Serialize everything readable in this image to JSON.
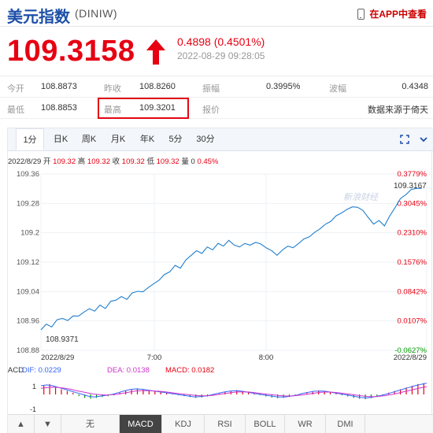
{
  "header": {
    "title": "美元指数",
    "code": "(DINIW)",
    "app_link": "在APP中查看"
  },
  "quote": {
    "price": "109.3158",
    "change": "0.4898 (0.4501%)",
    "time": "2022-08-29 09:28:05"
  },
  "stats": {
    "row1": [
      {
        "label": "今开",
        "value": "108.8873"
      },
      {
        "label": "昨收",
        "value": "108.8260"
      },
      {
        "label": "振幅",
        "value": "0.3995%"
      },
      {
        "label": "波幅",
        "value": "0.4348"
      }
    ],
    "row2": [
      {
        "label": "最低",
        "value": "108.8853"
      },
      {
        "label": "最高",
        "value": "109.3201"
      },
      {
        "label": "报价",
        "value": "数据来源于倚天"
      }
    ]
  },
  "tabs": [
    "1分",
    "日K",
    "周K",
    "月K",
    "年K",
    "5分",
    "30分"
  ],
  "info_line": {
    "date": "2022/8/29",
    "open_label": "开",
    "open": "109.32",
    "high_label": "高",
    "high": "109.32",
    "close_label": "收",
    "close": "109.32",
    "low_label": "低",
    "low": "109.32",
    "vol_label": "量",
    "vol": "0",
    "pct": "0.45%"
  },
  "bottom_tabs": [
    "无",
    "MACD",
    "KDJ",
    "RSI",
    "BOLL",
    "WR",
    "DMI"
  ],
  "chart_data": {
    "type": "line",
    "y_ticks": [
      "109.36",
      "109.28",
      "109.2",
      "109.12",
      "109.04",
      "108.96",
      "108.88"
    ],
    "pct_ticks": [
      "0.3779%",
      "0.3045%",
      "0.2310%",
      "0.1576%",
      "0.0842%",
      "0.0107%",
      "-0.0627%"
    ],
    "x_ticks": [
      "2022/8/29",
      "7:00",
      "8:00",
      "2022/8/29"
    ],
    "ylim": [
      108.88,
      109.36
    ],
    "annotations": {
      "min_label": "108.9371",
      "last_label": "109.3167"
    },
    "watermark": "新浪财经",
    "series": [
      {
        "values": [
          108.9371,
          108.95,
          108.945,
          108.962,
          108.968,
          108.96,
          108.975,
          108.972,
          108.985,
          108.992,
          108.988,
          109.002,
          108.995,
          109.012,
          109.018,
          109.025,
          109.02,
          109.035,
          109.042,
          109.038,
          109.052,
          109.06,
          109.072,
          109.085,
          109.095,
          109.11,
          109.105,
          109.125,
          109.14,
          109.15,
          109.145,
          109.16,
          109.155,
          109.17,
          109.165,
          109.178,
          109.168,
          109.16,
          109.172,
          109.165,
          109.175,
          109.168,
          109.16,
          109.15,
          109.14,
          109.152,
          109.165,
          109.158,
          109.172,
          109.182,
          109.19,
          109.2,
          109.212,
          109.222,
          109.232,
          109.245,
          109.255,
          109.262,
          109.272,
          109.268,
          109.262,
          109.24,
          109.225,
          109.232,
          109.22,
          109.245,
          109.27,
          109.292,
          109.305,
          109.3167,
          109.322,
          109.32
        ]
      }
    ],
    "macd": {
      "dif": "DIF: 0.0229",
      "dea": "DEA: 0.0138",
      "macd": "MACD: 0.0182",
      "y_ticks": [
        "1",
        "-1"
      ],
      "hist": [
        0.5,
        0.6,
        0.4,
        0.3,
        0.2,
        0.1,
        -0.1,
        -0.2,
        -0.25,
        -0.2,
        -0.15,
        -0.1,
        -0.05,
        0.1,
        0.2,
        0.3,
        0.35,
        0.3,
        0.25,
        0.2,
        0.15,
        0.1,
        0.05,
        -0.05,
        -0.1,
        -0.15,
        -0.2,
        -0.18,
        -0.12,
        -0.05,
        0.05,
        0.15,
        0.2,
        0.25,
        0.2,
        0.12,
        0.05,
        -0.05,
        -0.12,
        -0.18,
        -0.22,
        -0.2,
        -0.15,
        -0.08,
        0.05,
        0.12,
        0.18,
        0.22,
        0.18,
        0.12,
        0.05,
        -0.05,
        -0.12,
        -0.2,
        -0.25,
        -0.28,
        -0.22,
        -0.15,
        -0.05,
        0.1,
        0.2,
        0.3,
        0.4,
        0.5,
        0.6,
        0.65
      ],
      "dif_line": [
        0.5,
        0.55,
        0.5,
        0.4,
        0.3,
        0.2,
        0.1,
        0.0,
        -0.1,
        -0.15,
        -0.1,
        -0.05,
        0.0,
        0.1,
        0.2,
        0.28,
        0.32,
        0.3,
        0.25,
        0.2,
        0.15,
        0.1,
        0.05,
        0.0,
        -0.05,
        -0.1,
        -0.15,
        -0.12,
        -0.08,
        0.0,
        0.08,
        0.15,
        0.2,
        0.22,
        0.18,
        0.12,
        0.05,
        0.0,
        -0.05,
        -0.1,
        -0.15,
        -0.15,
        -0.1,
        -0.05,
        0.05,
        0.12,
        0.18,
        0.2,
        0.18,
        0.12,
        0.06,
        0.0,
        -0.06,
        -0.12,
        -0.18,
        -0.2,
        -0.15,
        -0.08,
        0.0,
        0.1,
        0.2,
        0.3,
        0.4,
        0.5,
        0.58,
        0.65
      ],
      "dea_line": [
        0.35,
        0.4,
        0.42,
        0.4,
        0.36,
        0.3,
        0.22,
        0.15,
        0.08,
        0.02,
        -0.02,
        -0.03,
        -0.02,
        0.02,
        0.08,
        0.14,
        0.2,
        0.22,
        0.22,
        0.2,
        0.18,
        0.15,
        0.1,
        0.06,
        0.02,
        -0.02,
        -0.06,
        -0.08,
        -0.08,
        -0.05,
        0.0,
        0.05,
        0.1,
        0.14,
        0.15,
        0.14,
        0.1,
        0.06,
        0.02,
        -0.02,
        -0.06,
        -0.09,
        -0.09,
        -0.07,
        -0.03,
        0.02,
        0.07,
        0.12,
        0.14,
        0.13,
        0.1,
        0.06,
        0.02,
        -0.03,
        -0.08,
        -0.12,
        -0.13,
        -0.11,
        -0.07,
        -0.01,
        0.06,
        0.14,
        0.22,
        0.3,
        0.38,
        0.45
      ]
    }
  },
  "colors": {
    "up": "#e60012",
    "down": "#009900",
    "line": "#1f7ecf",
    "dif": "#3366ff",
    "dea": "#cc33cc",
    "macd": "#e60012",
    "title": "#1d4fa8"
  },
  "icons": {
    "phone": "phone-icon",
    "arrow": "up-arrow-icon",
    "fullscreen": "fullscreen-icon"
  }
}
